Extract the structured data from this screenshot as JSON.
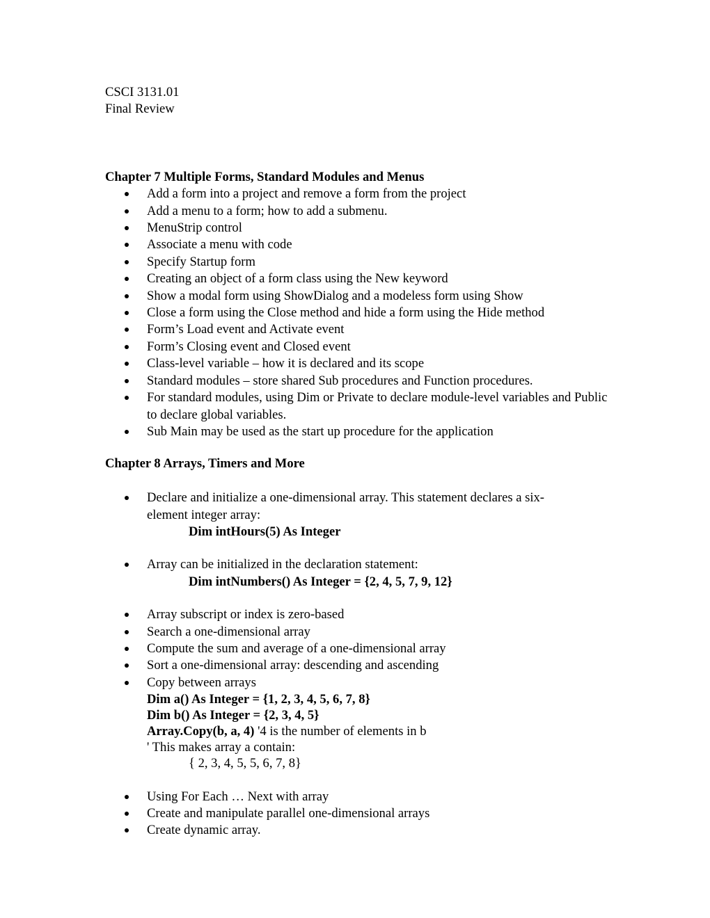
{
  "header": {
    "course": "CSCI 3131.01",
    "title": "Final Review"
  },
  "chapter7": {
    "heading": "Chapter 7 Multiple Forms, Standard Modules and Menus",
    "items": [
      "Add a form into a project and remove a form from the project",
      "Add a menu to a form; how to add a submenu.",
      "MenuStrip control",
      "Associate a menu with code",
      "Specify Startup form",
      "Creating an object of a form class using the New keyword",
      "Show a modal form using ShowDialog and a modeless form using Show",
      "Close a form using the Close method and hide a form using the Hide method",
      "Form’s Load event and Activate event",
      "Form’s Closing event and Closed event",
      "Class-level variable – how it is declared and its scope",
      "Standard modules – store shared Sub procedures and Function procedures.",
      "For standard modules, using Dim or Private to declare module-level variables and Public to declare global variables.",
      "Sub Main may be used as the start up procedure for the application"
    ]
  },
  "chapter8": {
    "heading": "Chapter 8 Arrays, Timers and More",
    "declare": {
      "text": "Declare and initialize a one-dimensional array. This statement declares a six-element integer array:",
      "code": "Dim intHours(5) As Integer"
    },
    "init": {
      "text": "Array can be initialized in the declaration statement:",
      "code": "Dim intNumbers() As Integer = {2, 4, 5, 7, 9, 12}"
    },
    "items_mid": [
      "Array subscript or index is zero-based",
      "Search a one-dimensional array",
      "Compute the sum and average of a one-dimensional array",
      "Sort a one-dimensional array: descending and ascending",
      "Copy between arrays"
    ],
    "copy_example": {
      "line1": "Dim a() As Integer = {1, 2, 3, 4, 5, 6, 7, 8}",
      "line2": "Dim b() As Integer = {2, 3, 4, 5}",
      "line3_code": "Array.Copy(b, a, 4)",
      "line3_comment": " '4 is the number of elements in b",
      "line4": "' This makes array a contain:",
      "line5": "{ 2, 3, 4, 5, 5, 6, 7, 8}"
    },
    "items_end": [
      "Using For Each … Next with array",
      "Create and manipulate parallel one-dimensional arrays",
      "Create dynamic array."
    ]
  }
}
